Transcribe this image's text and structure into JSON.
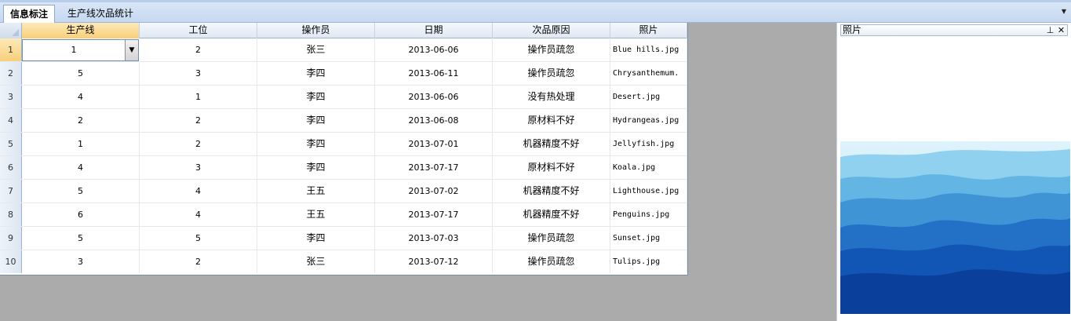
{
  "tabs": [
    {
      "label": "信息标注",
      "active": true
    },
    {
      "label": "生产线次品统计",
      "active": false
    }
  ],
  "grid": {
    "columns": [
      "生产线",
      "工位",
      "操作员",
      "日期",
      "次品原因",
      "照片"
    ],
    "rows": [
      {
        "num": "1",
        "line": "1",
        "station": "2",
        "operator": "张三",
        "date": "2013-06-06",
        "reason": "操作员疏忽",
        "photo": "Blue hills.jpg"
      },
      {
        "num": "2",
        "line": "5",
        "station": "3",
        "operator": "李四",
        "date": "2013-06-11",
        "reason": "操作员疏忽",
        "photo": "Chrysanthemum."
      },
      {
        "num": "3",
        "line": "4",
        "station": "1",
        "operator": "李四",
        "date": "2013-06-06",
        "reason": "没有热处理",
        "photo": "Desert.jpg"
      },
      {
        "num": "4",
        "line": "2",
        "station": "2",
        "operator": "李四",
        "date": "2013-06-08",
        "reason": "原材料不好",
        "photo": "Hydrangeas.jpg"
      },
      {
        "num": "5",
        "line": "1",
        "station": "2",
        "operator": "李四",
        "date": "2013-07-01",
        "reason": "机器精度不好",
        "photo": "Jellyfish.jpg"
      },
      {
        "num": "6",
        "line": "4",
        "station": "3",
        "operator": "李四",
        "date": "2013-07-17",
        "reason": "原材料不好",
        "photo": "Koala.jpg"
      },
      {
        "num": "7",
        "line": "5",
        "station": "4",
        "operator": "王五",
        "date": "2013-07-02",
        "reason": "机器精度不好",
        "photo": "Lighthouse.jpg"
      },
      {
        "num": "8",
        "line": "6",
        "station": "4",
        "operator": "王五",
        "date": "2013-07-17",
        "reason": "机器精度不好",
        "photo": "Penguins.jpg"
      },
      {
        "num": "9",
        "line": "5",
        "station": "5",
        "operator": "李四",
        "date": "2013-07-03",
        "reason": "操作员疏忽",
        "photo": "Sunset.jpg"
      },
      {
        "num": "10",
        "line": "3",
        "station": "2",
        "operator": "张三",
        "date": "2013-07-12",
        "reason": "操作员疏忽",
        "photo": "Tulips.jpg"
      }
    ]
  },
  "photo_panel": {
    "title": "照片",
    "pin_icon": "pin-icon",
    "close_icon": "close-icon"
  },
  "colors": {
    "selected_header": "#f8cf7a",
    "background": "#ababab"
  }
}
